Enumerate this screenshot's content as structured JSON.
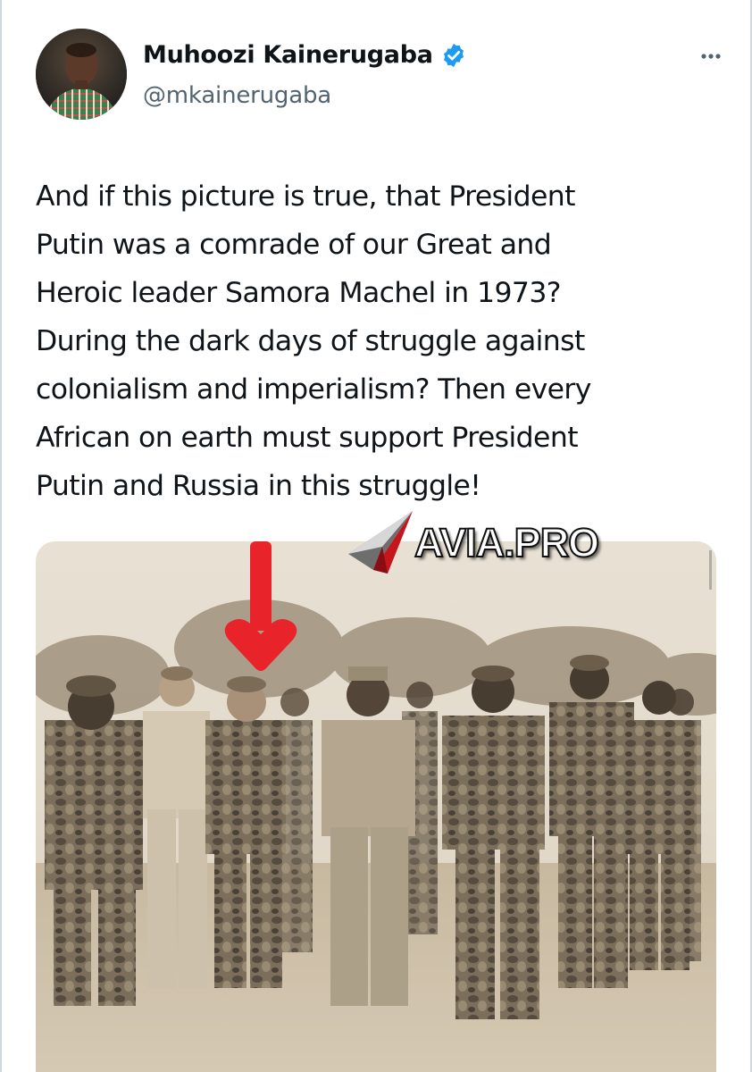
{
  "post": {
    "author_name": "Muhoozi Kainerugaba",
    "author_handle": "@mkainerugaba",
    "verified": true,
    "more_label": "More",
    "text_lines": [
      "And if this picture is true, that President",
      "Putin was a comrade of our Great and",
      "Heroic leader Samora Machel in 1973?",
      "During the dark days of struggle against",
      "colonialism and imperialism? Then every",
      "African on earth must support President",
      "Putin and Russia in this struggle!"
    ]
  },
  "watermark": {
    "text": "AVIA.PRO"
  },
  "icons": {
    "verified": "verified-badge-icon",
    "more": "more-options-icon",
    "annotation": "red-down-arrow-icon"
  },
  "colors": {
    "accent": "#1d9bf0",
    "text": "#0f1419",
    "secondary_text": "#536471",
    "photo_sepia": "#c9bba3",
    "arrow_red": "#e8242a"
  }
}
